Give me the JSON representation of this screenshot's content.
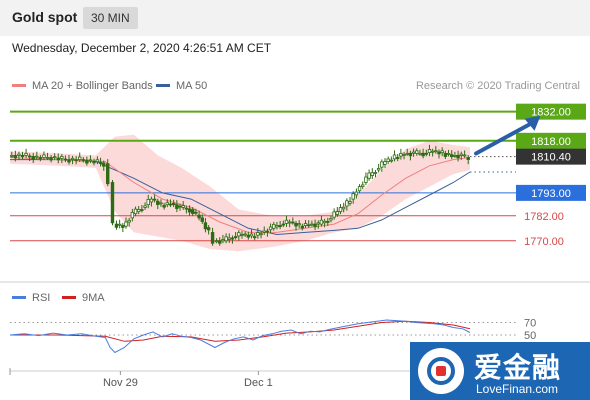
{
  "header": {
    "title": "Gold spot",
    "timeframe": "30 MIN"
  },
  "date_line": "Wednesday, December 2, 2020 4:26:51 AM CET",
  "legend": {
    "bollinger_label": "MA 20 + Bollinger Bands",
    "ma50_label": "MA 50",
    "credit": "Research © 2020 Trading Central"
  },
  "colors": {
    "green_level": "#5aa816",
    "blue_level": "#2a6fdb",
    "red_level": "#d84848",
    "bollinger_fill": "#fbd3d3",
    "ma20": "#f08080",
    "ma50": "#3a5f9b",
    "arrow": "#2b5ea8",
    "candle": "#2e6b14",
    "rsi": "#4a7de0",
    "rsi_ma": "#d02020"
  },
  "watermark": {
    "cn_text": "爱金融",
    "en_text": "LoveFinan.com",
    "logo_icon": "lovefinan-logo"
  },
  "chart_data": [
    {
      "type": "candlestick",
      "y_range": [
        1755,
        1840
      ],
      "x_labels": [
        {
          "label": "Nov 29",
          "pos": 0.24
        },
        {
          "label": "Dec 1",
          "pos": 0.54
        }
      ],
      "last_price": 1810.4,
      "levels": [
        {
          "value": 1832.0,
          "label": "1832.00",
          "kind": "resistance",
          "color": "#5aa816",
          "tag": "box"
        },
        {
          "value": 1818.0,
          "label": "1818.00",
          "kind": "resistance",
          "color": "#5aa816",
          "tag": "box"
        },
        {
          "value": 1810.4,
          "label": "1810.40",
          "kind": "last",
          "color": "#333333",
          "tag": "box"
        },
        {
          "value": 1793.0,
          "label": "1793.00",
          "kind": "pivot",
          "color": "#2a6fdb",
          "tag": "box"
        },
        {
          "value": 1782.0,
          "label": "1782.00",
          "kind": "support",
          "color": "#d84848",
          "tag": "text"
        },
        {
          "value": 1770.0,
          "label": "1770.00",
          "kind": "support",
          "color": "#d84848",
          "tag": "text"
        }
      ],
      "price_path": [
        [
          0,
          1811
        ],
        [
          6,
          1811
        ],
        [
          12,
          1810
        ],
        [
          18,
          1810
        ],
        [
          24,
          1809
        ],
        [
          30,
          1809
        ],
        [
          36,
          1808
        ],
        [
          40,
          1807
        ],
        [
          42,
          1798
        ],
        [
          44,
          1778
        ],
        [
          48,
          1777
        ],
        [
          52,
          1783
        ],
        [
          56,
          1786
        ],
        [
          60,
          1790
        ],
        [
          64,
          1787
        ],
        [
          68,
          1788
        ],
        [
          72,
          1786
        ],
        [
          76,
          1785
        ],
        [
          80,
          1781
        ],
        [
          84,
          1774
        ],
        [
          86,
          1770
        ],
        [
          90,
          1770
        ],
        [
          94,
          1772
        ],
        [
          98,
          1773
        ],
        [
          102,
          1772
        ],
        [
          106,
          1774
        ],
        [
          110,
          1776
        ],
        [
          114,
          1778
        ],
        [
          118,
          1779
        ],
        [
          122,
          1777
        ],
        [
          126,
          1778
        ],
        [
          130,
          1778
        ],
        [
          134,
          1780
        ],
        [
          138,
          1784
        ],
        [
          142,
          1788
        ],
        [
          146,
          1794
        ],
        [
          150,
          1800
        ],
        [
          154,
          1804
        ],
        [
          158,
          1808
        ],
        [
          162,
          1810
        ],
        [
          166,
          1812
        ],
        [
          170,
          1812
        ],
        [
          174,
          1812
        ],
        [
          178,
          1813
        ],
        [
          182,
          1812
        ],
        [
          186,
          1811
        ],
        [
          190,
          1811
        ],
        [
          193,
          1809
        ]
      ],
      "ma20": [
        [
          0,
          1810
        ],
        [
          20,
          1809
        ],
        [
          40,
          1808
        ],
        [
          52,
          1798
        ],
        [
          64,
          1790
        ],
        [
          76,
          1786
        ],
        [
          88,
          1779
        ],
        [
          100,
          1774
        ],
        [
          112,
          1774
        ],
        [
          124,
          1776
        ],
        [
          136,
          1778
        ],
        [
          146,
          1783
        ],
        [
          156,
          1792
        ],
        [
          166,
          1800
        ],
        [
          176,
          1806
        ],
        [
          186,
          1809
        ],
        [
          193,
          1810
        ]
      ],
      "bollinger_upper": [
        [
          0,
          1813
        ],
        [
          20,
          1812
        ],
        [
          36,
          1811
        ],
        [
          44,
          1820
        ],
        [
          52,
          1821
        ],
        [
          62,
          1811
        ],
        [
          72,
          1805
        ],
        [
          84,
          1796
        ],
        [
          96,
          1785
        ],
        [
          110,
          1782
        ],
        [
          124,
          1782
        ],
        [
          136,
          1784
        ],
        [
          146,
          1792
        ],
        [
          156,
          1804
        ],
        [
          166,
          1814
        ],
        [
          176,
          1818
        ],
        [
          186,
          1816
        ],
        [
          193,
          1815
        ]
      ],
      "bollinger_lower": [
        [
          0,
          1807
        ],
        [
          20,
          1806
        ],
        [
          36,
          1805
        ],
        [
          44,
          1784
        ],
        [
          52,
          1774
        ],
        [
          62,
          1772
        ],
        [
          72,
          1770
        ],
        [
          84,
          1766
        ],
        [
          96,
          1765
        ],
        [
          110,
          1767
        ],
        [
          124,
          1770
        ],
        [
          136,
          1774
        ],
        [
          146,
          1776
        ],
        [
          156,
          1782
        ],
        [
          166,
          1790
        ],
        [
          176,
          1796
        ],
        [
          186,
          1802
        ],
        [
          193,
          1804
        ]
      ],
      "ma50": [
        [
          0,
          1809
        ],
        [
          20,
          1809
        ],
        [
          36,
          1808
        ],
        [
          52,
          1800
        ],
        [
          64,
          1793
        ],
        [
          76,
          1790
        ],
        [
          88,
          1783
        ],
        [
          100,
          1776
        ],
        [
          112,
          1773
        ],
        [
          124,
          1774
        ],
        [
          136,
          1775
        ],
        [
          146,
          1776
        ],
        [
          156,
          1780
        ],
        [
          166,
          1786
        ],
        [
          176,
          1792
        ],
        [
          186,
          1798
        ],
        [
          193,
          1803
        ]
      ],
      "forecast_arrow": {
        "from": [
          193,
          1810
        ],
        "to": [
          210,
          1831
        ]
      }
    },
    {
      "type": "line",
      "legend": [
        "RSI",
        "9MA"
      ],
      "y_ticks": [
        70,
        50
      ],
      "y_range": [
        10,
        90
      ],
      "rsi": [
        [
          0,
          50
        ],
        [
          6,
          52
        ],
        [
          12,
          49
        ],
        [
          18,
          53
        ],
        [
          24,
          50
        ],
        [
          30,
          52
        ],
        [
          36,
          48
        ],
        [
          40,
          46
        ],
        [
          42,
          30
        ],
        [
          44,
          22
        ],
        [
          48,
          30
        ],
        [
          52,
          44
        ],
        [
          56,
          50
        ],
        [
          60,
          55
        ],
        [
          64,
          47
        ],
        [
          68,
          52
        ],
        [
          72,
          48
        ],
        [
          76,
          46
        ],
        [
          80,
          42
        ],
        [
          84,
          34
        ],
        [
          86,
          30
        ],
        [
          90,
          38
        ],
        [
          94,
          44
        ],
        [
          98,
          47
        ],
        [
          102,
          42
        ],
        [
          106,
          49
        ],
        [
          110,
          52
        ],
        [
          114,
          56
        ],
        [
          118,
          58
        ],
        [
          122,
          52
        ],
        [
          126,
          56
        ],
        [
          130,
          55
        ],
        [
          134,
          59
        ],
        [
          138,
          62
        ],
        [
          142,
          65
        ],
        [
          146,
          68
        ],
        [
          150,
          70
        ],
        [
          154,
          72
        ],
        [
          158,
          74
        ],
        [
          162,
          73
        ],
        [
          166,
          72
        ],
        [
          170,
          70
        ],
        [
          174,
          69
        ],
        [
          178,
          68
        ],
        [
          182,
          66
        ],
        [
          186,
          62
        ],
        [
          190,
          60
        ],
        [
          193,
          54
        ]
      ],
      "rsi_ma": [
        [
          0,
          50
        ],
        [
          20,
          50
        ],
        [
          40,
          48
        ],
        [
          48,
          40
        ],
        [
          56,
          42
        ],
        [
          64,
          48
        ],
        [
          76,
          47
        ],
        [
          86,
          40
        ],
        [
          96,
          42
        ],
        [
          106,
          47
        ],
        [
          116,
          53
        ],
        [
          126,
          55
        ],
        [
          136,
          58
        ],
        [
          146,
          64
        ],
        [
          156,
          70
        ],
        [
          166,
          72
        ],
        [
          176,
          70
        ],
        [
          186,
          66
        ],
        [
          193,
          60
        ]
      ]
    }
  ]
}
